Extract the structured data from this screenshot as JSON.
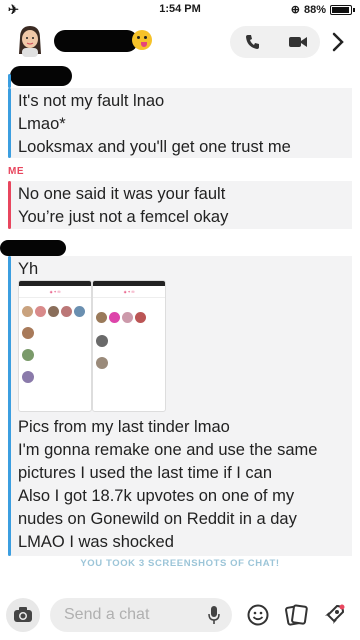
{
  "status_bar": {
    "time": "1:54 PM",
    "battery": "88%",
    "battery_level": 0.88
  },
  "header": {
    "call_icon": "phone-icon",
    "video_icon": "video-camera-icon",
    "forward_icon": "chevron-right-icon"
  },
  "messages": {
    "first": {
      "lines": [
        "It's not my fault lnao",
        "Lmao*",
        "Looksmax and you'll get one trust me"
      ],
      "color": "#3b9ee0"
    },
    "me": {
      "sender": "ME",
      "lines": [
        "No one said it was your fault",
        "You’re just not a femcel okay"
      ],
      "color": "#e8465e"
    },
    "second": {
      "lines": [
        "Yh",
        "Pics from my last tinder lmao",
        "I'm gonna remake one and use the same",
        "pictures I used the last time if I can",
        "Also I got 18.7k upvotes on one of my",
        "nudes on Gonewild on Reddit in a day",
        "LMAO I was shocked"
      ],
      "color": "#3b9ee0"
    }
  },
  "screenshot_notice": "YOU TOOK 3 SCREENSHOTS OF CHAT!",
  "composer": {
    "placeholder": "Send a chat"
  },
  "colors": {
    "accent_blue": "#3b9ee0",
    "accent_red": "#e8465e",
    "notice": "#9cc5d8"
  }
}
